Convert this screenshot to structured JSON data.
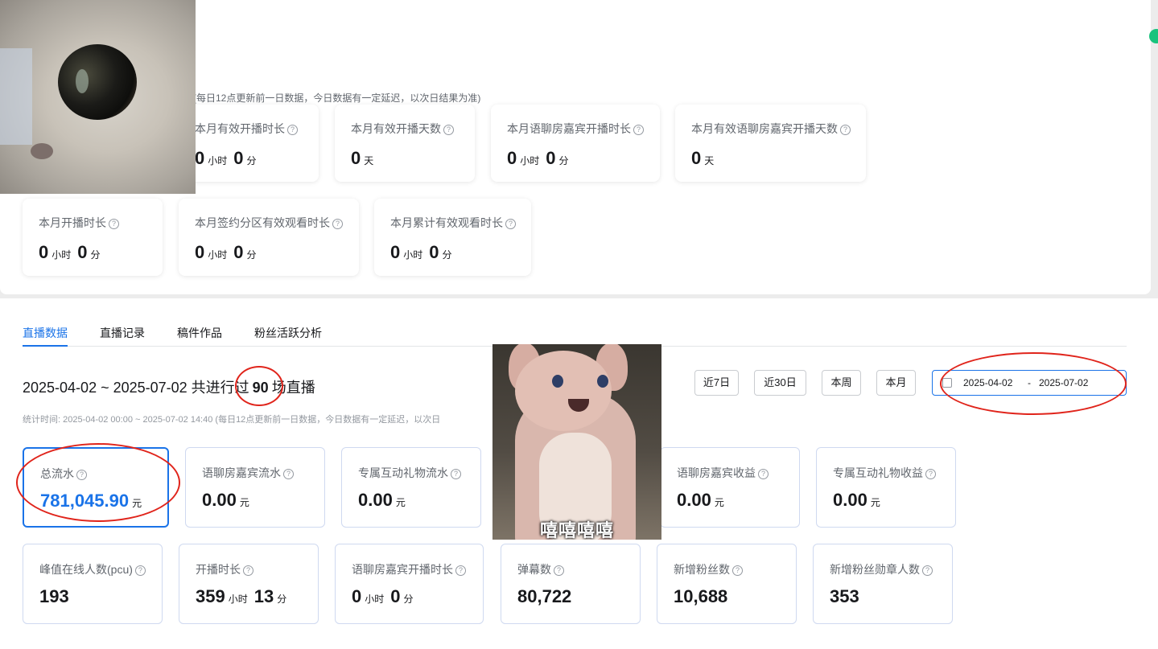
{
  "top_section": {
    "note": "(每日12点更新前一日数据，今日数据有一定延迟，以次日结果为准)",
    "row1": [
      {
        "title": "本月有效开播时长",
        "kind": "hm",
        "hours": "0",
        "hours_unit": "小时",
        "minutes": "0",
        "minutes_unit": "分"
      },
      {
        "title": "本月有效开播天数",
        "kind": "single",
        "value": "0",
        "unit": "天"
      },
      {
        "title": "本月语聊房嘉宾开播时长",
        "kind": "hm",
        "hours": "0",
        "hours_unit": "小时",
        "minutes": "0",
        "minutes_unit": "分"
      },
      {
        "title": "本月有效语聊房嘉宾开播天数",
        "kind": "single",
        "value": "0",
        "unit": "天"
      }
    ],
    "row2": [
      {
        "title": "本月开播时长",
        "hours": "0",
        "hours_unit": "小时",
        "minutes": "0",
        "minutes_unit": "分"
      },
      {
        "title": "本月签约分区有效观看时长",
        "hours": "0",
        "hours_unit": "小时",
        "minutes": "0",
        "minutes_unit": "分"
      },
      {
        "title": "本月累计有效观看时长",
        "hours": "0",
        "hours_unit": "小时",
        "minutes": "0",
        "minutes_unit": "分"
      }
    ]
  },
  "tabs": [
    "直播数据",
    "直播记录",
    "稿件作品",
    "粉丝活跃分析"
  ],
  "summary": {
    "prefix": "2025-04-02 ~ 2025-07-02 共进行过",
    "count": "90",
    "suffix": "场直播",
    "stat_time": "统计时间:   2025-04-02 00:00 ~ 2025-07-02 14:40      (每日12点更新前一日数据，今日数据有一定延迟，以次日"
  },
  "range_buttons": [
    "近7日",
    "近30日",
    "本周",
    "本月"
  ],
  "date_range": {
    "start": "2025-04-02",
    "separator": "-",
    "end": "2025-07-02"
  },
  "metrics_row1": [
    {
      "title": "总流水",
      "value": "781,045.90",
      "unit": "元"
    },
    {
      "title": "语聊房嘉宾流水",
      "value": "0.00",
      "unit": "元"
    },
    {
      "title": "专属互动礼物流水",
      "value": "0.00",
      "unit": "元"
    },
    {
      "title": "语聊房嘉宾收益",
      "value": "0.00",
      "unit": "元"
    },
    {
      "title": "专属互动礼物收益",
      "value": "0.00",
      "unit": "元"
    }
  ],
  "metrics_row2": [
    {
      "title": "峰值在线人数(pcu)",
      "value": "193"
    },
    {
      "title": "开播时长",
      "hours": "359",
      "hours_unit": "小时",
      "minutes": "13",
      "minutes_unit": "分"
    },
    {
      "title": "语聊房嘉宾开播时长",
      "hours": "0",
      "hours_unit": "小时",
      "minutes": "0",
      "minutes_unit": "分"
    },
    {
      "title": "弹幕数",
      "value": "80,722"
    },
    {
      "title": "新增粉丝数",
      "value": "10,688"
    },
    {
      "title": "新增粉丝勋章人数",
      "value": "353"
    }
  ],
  "overlay": {
    "bunny_caption": "嘻嘻嘻嘻"
  },
  "colors": {
    "accent": "#1a73e8",
    "annotation": "#e0241b",
    "status_dot": "#19c37d"
  }
}
